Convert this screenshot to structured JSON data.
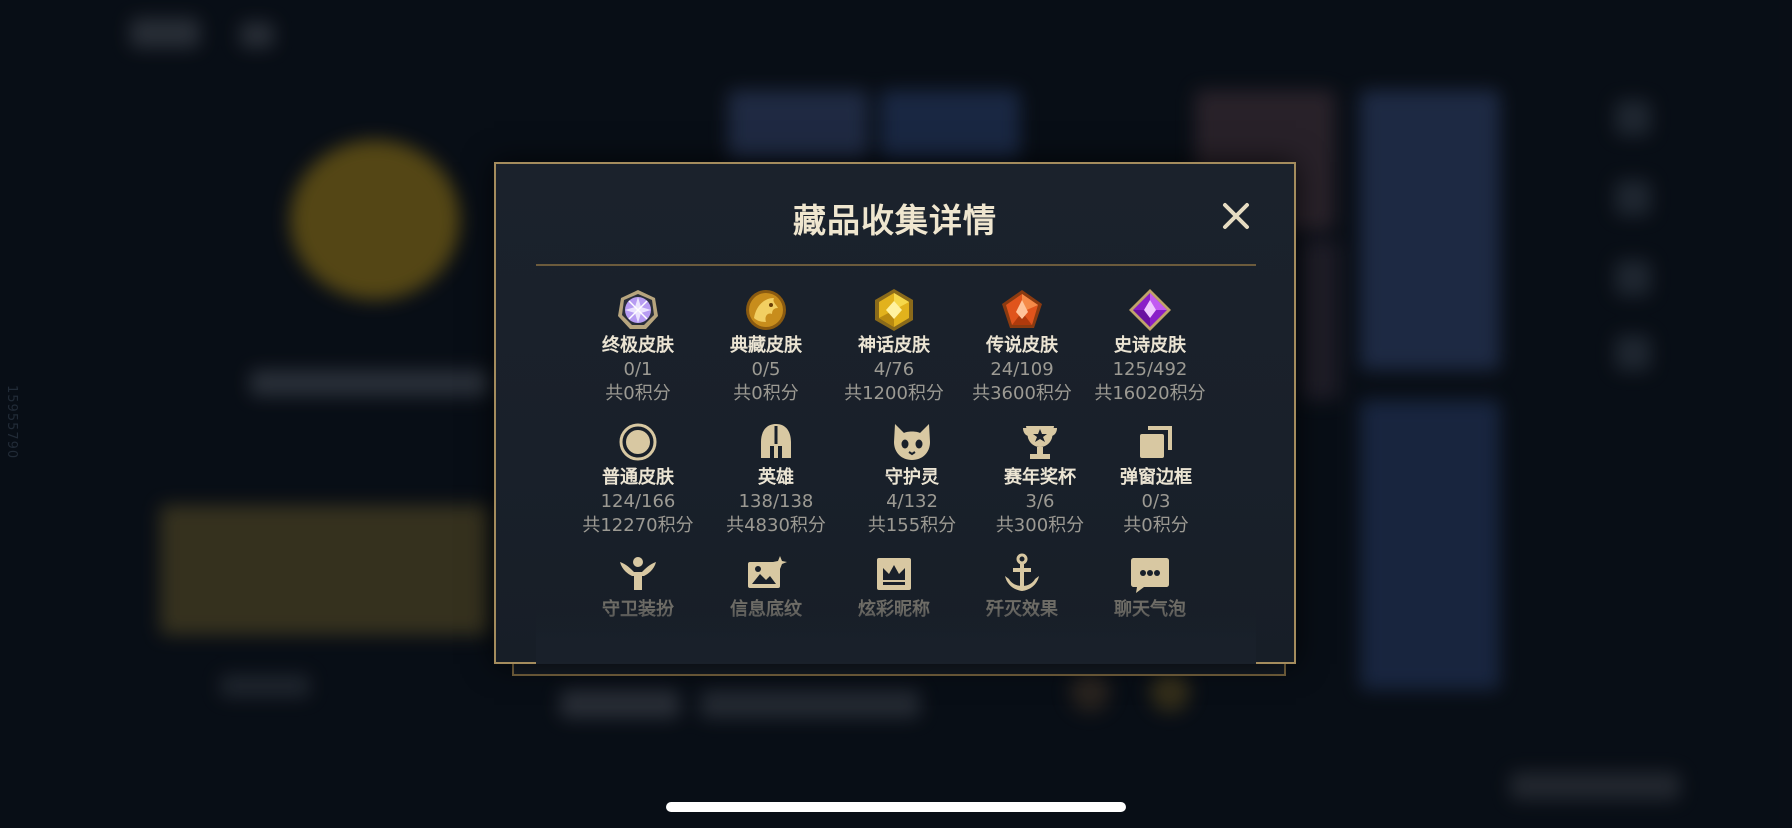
{
  "background": {
    "side_id": "15955790"
  },
  "modal": {
    "title": "藏品收集详情",
    "rows": [
      [
        {
          "icon": "ultimate-skin-icon",
          "name": "终极皮肤",
          "count": "0/1",
          "points": "共0积分"
        },
        {
          "icon": "prestige-skin-icon",
          "name": "典藏皮肤",
          "count": "0/5",
          "points": "共0积分"
        },
        {
          "icon": "mythic-skin-icon",
          "name": "神话皮肤",
          "count": "4/76",
          "points": "共1200积分"
        },
        {
          "icon": "legendary-skin-icon",
          "name": "传说皮肤",
          "count": "24/109",
          "points": "共3600积分"
        },
        {
          "icon": "epic-skin-icon",
          "name": "史诗皮肤",
          "count": "125/492",
          "points": "共16020积分"
        }
      ],
      [
        {
          "icon": "common-skin-icon",
          "name": "普通皮肤",
          "count": "124/166",
          "points": "共12270积分"
        },
        {
          "icon": "helmet-icon",
          "name": "英雄",
          "count": "138/138",
          "points": "共4830积分"
        },
        {
          "icon": "guardian-creature-icon",
          "name": "守护灵",
          "count": "4/132",
          "points": "共155积分"
        },
        {
          "icon": "trophy-icon",
          "name": "赛年奖杯",
          "count": "3/6",
          "points": "共300积分"
        },
        {
          "icon": "popup-frame-icon",
          "name": "弹窗边框",
          "count": "0/3",
          "points": "共0积分"
        }
      ],
      [
        {
          "icon": "ward-skin-icon",
          "name": "守卫装扮"
        },
        {
          "icon": "info-pattern-icon",
          "name": "信息底纹"
        },
        {
          "icon": "crown-nameplate-icon",
          "name": "炫彩昵称"
        },
        {
          "icon": "anchor-icon",
          "name": "歼灭效果"
        },
        {
          "icon": "chat-bubble-icon",
          "name": "聊天气泡"
        }
      ]
    ]
  },
  "colors": {
    "gold_border": "#a48c5d",
    "icon_gold": "#d8c8a2",
    "title_text": "#efe6cf"
  }
}
